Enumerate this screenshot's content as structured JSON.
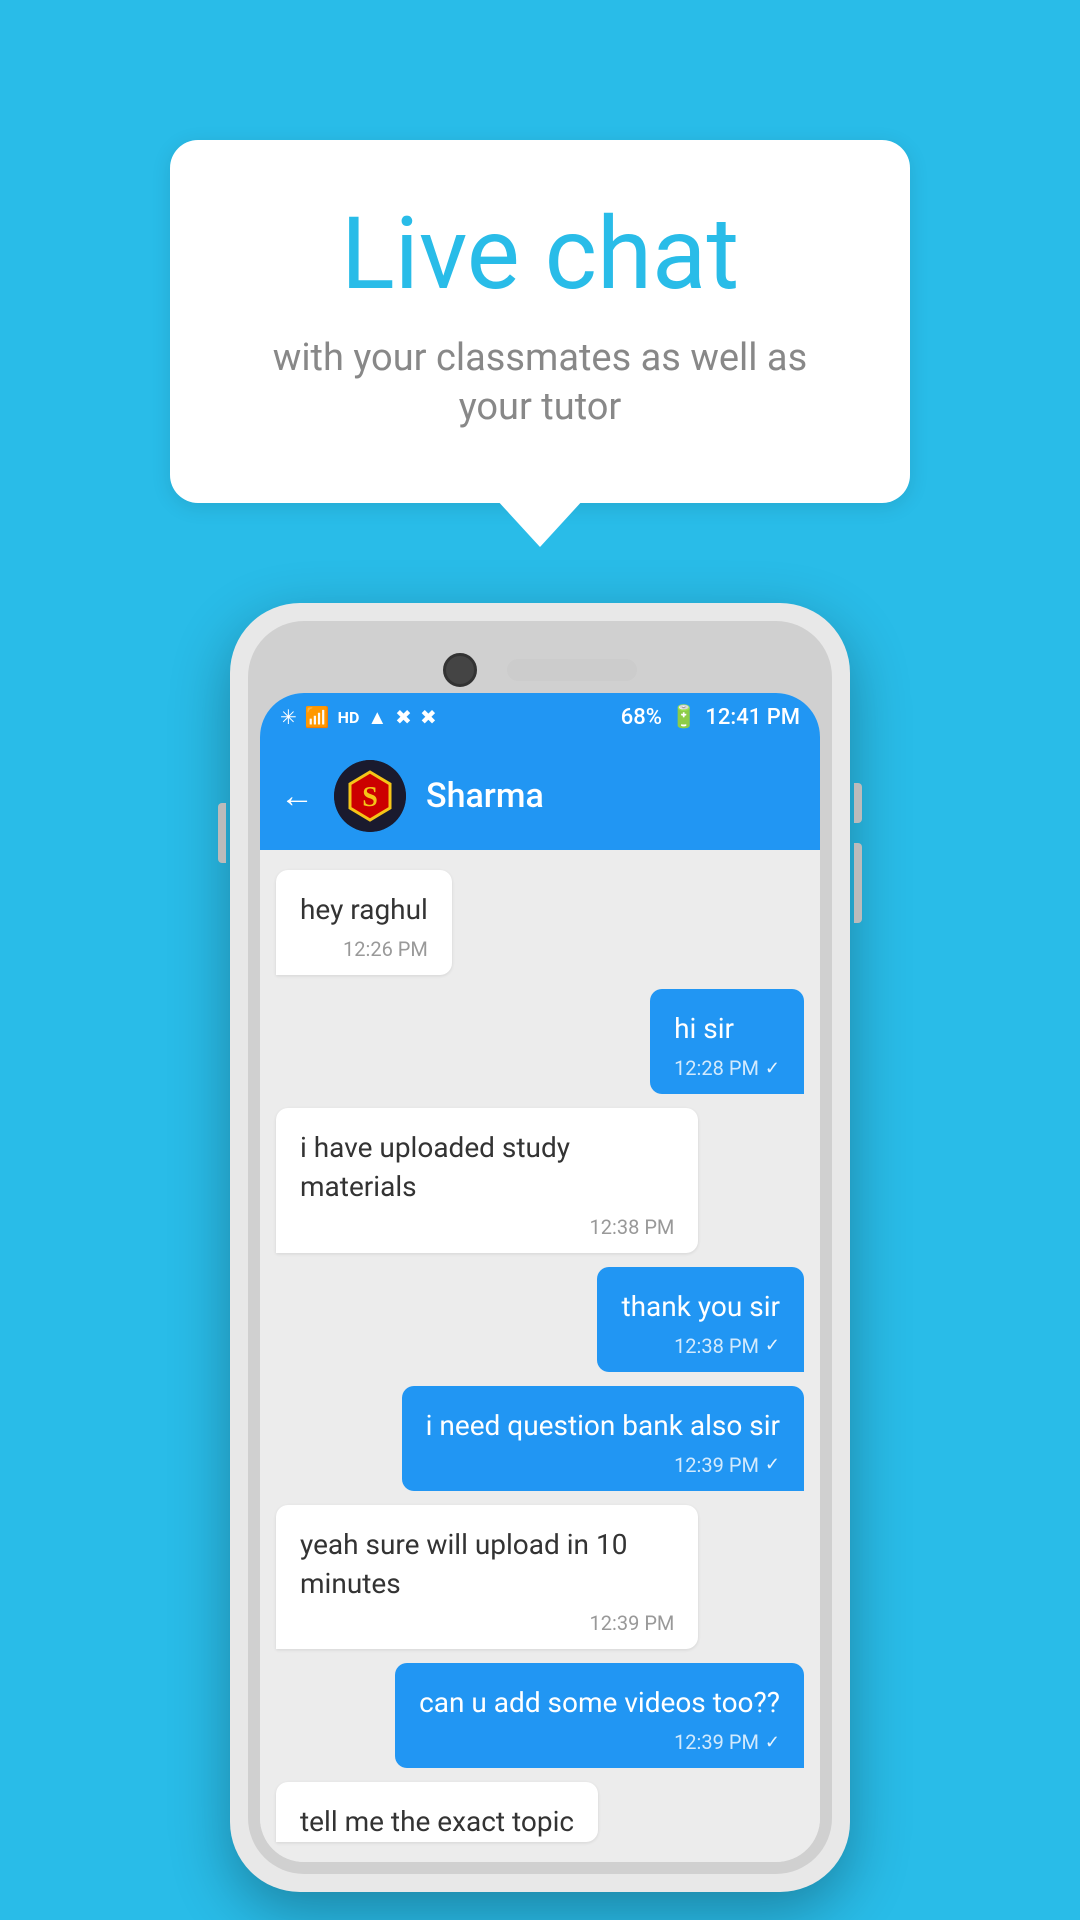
{
  "bubble": {
    "title": "Live chat",
    "subtitle": "with your classmates as well as your tutor"
  },
  "status_bar": {
    "time": "12:41 PM",
    "battery": "68%",
    "icons_left": "🔷 📳 HD ⬆ ▲ ✖ ✖"
  },
  "chat_header": {
    "contact_name": "Sharma",
    "back_label": "←"
  },
  "messages": [
    {
      "id": 1,
      "type": "received",
      "text": "hey raghul",
      "time": "12:26 PM",
      "check": false
    },
    {
      "id": 2,
      "type": "sent",
      "text": "hi sir",
      "time": "12:28 PM",
      "check": true
    },
    {
      "id": 3,
      "type": "received",
      "text": "i have uploaded study materials",
      "time": "12:38 PM",
      "check": false
    },
    {
      "id": 4,
      "type": "sent",
      "text": "thank you sir",
      "time": "12:38 PM",
      "check": true
    },
    {
      "id": 5,
      "type": "sent",
      "text": "i need question bank also sir",
      "time": "12:39 PM",
      "check": true
    },
    {
      "id": 6,
      "type": "received",
      "text": "yeah sure will upload in 10 minutes",
      "time": "12:39 PM",
      "check": false
    },
    {
      "id": 7,
      "type": "sent",
      "text": "can u add some videos too??",
      "time": "12:39 PM",
      "check": true
    },
    {
      "id": 8,
      "type": "received",
      "text": "tell me the exact topic",
      "time": "",
      "check": false,
      "partial": true
    }
  ]
}
